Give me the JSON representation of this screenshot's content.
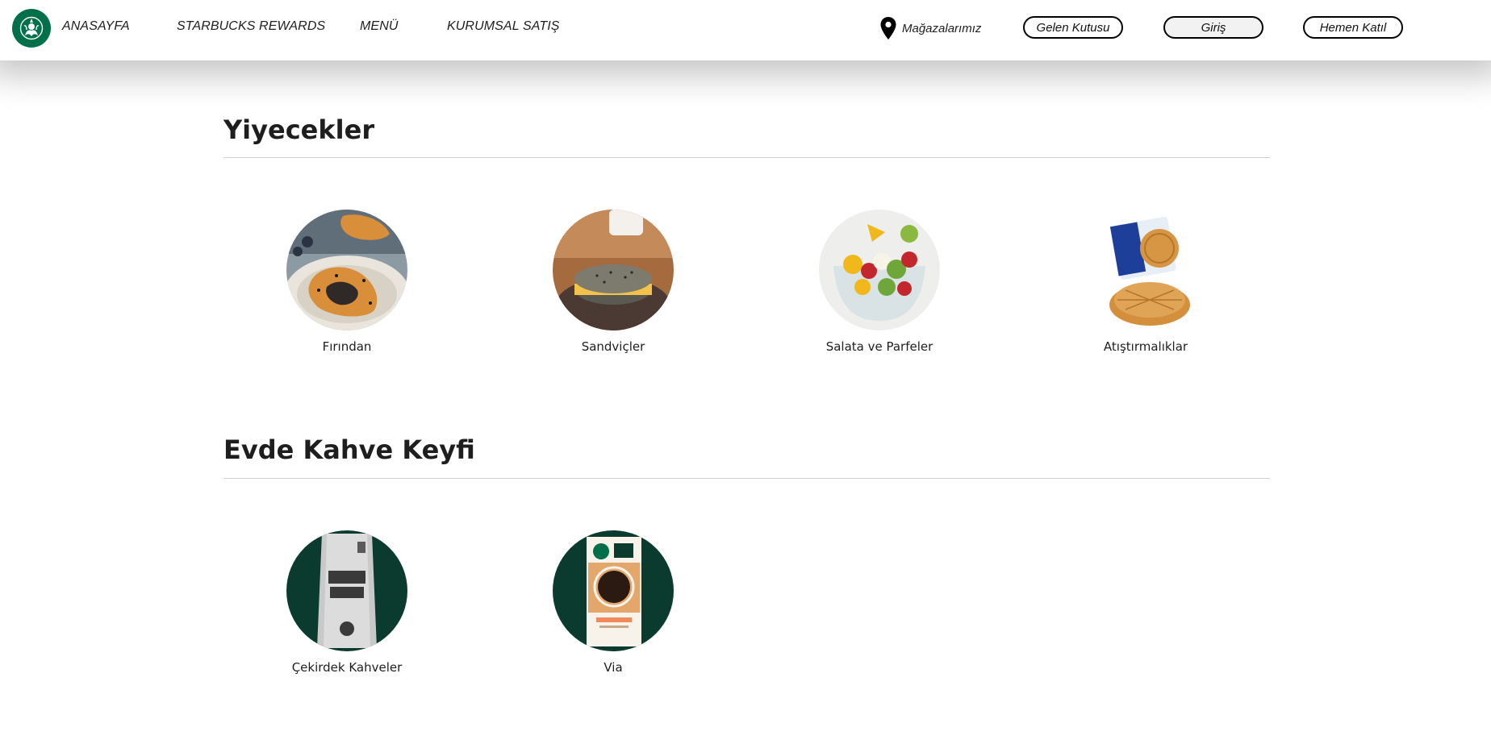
{
  "header": {
    "logo_icon": "starbucks-siren-logo",
    "nav": [
      {
        "label": "ANASAYFA"
      },
      {
        "label": "STARBUCKS REWARDS"
      },
      {
        "label": "MENÜ"
      },
      {
        "label": "KURUMSAL SATIŞ"
      }
    ],
    "stores": {
      "label": "Mağazalarımız",
      "icon": "map-pin-icon"
    },
    "buttons": {
      "inbox": "Gelen Kutusu",
      "login": "Giriş",
      "join": "Hemen Katıl"
    }
  },
  "sections": [
    {
      "title": "Yiyecekler",
      "items": [
        {
          "label": "Fırından"
        },
        {
          "label": "Sandviçler"
        },
        {
          "label": "Salata ve Parfeler"
        },
        {
          "label": "Atıştırmalıklar"
        }
      ]
    },
    {
      "title": "Evde Kahve Keyfi",
      "items": [
        {
          "label": "Çekirdek Kahveler"
        },
        {
          "label": "Via"
        }
      ]
    }
  ],
  "theme": {
    "brand_green": "#00704a",
    "dark_green": "#0b3b2e"
  }
}
